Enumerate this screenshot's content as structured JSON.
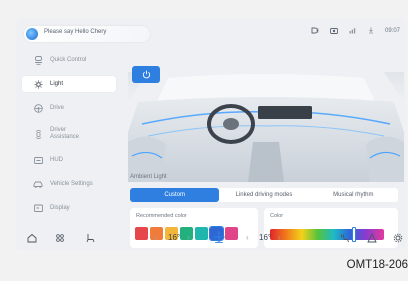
{
  "status_bar": {
    "voice_prompt": "Please say Hello Chery",
    "time": "09:07"
  },
  "sidebar": {
    "items": [
      {
        "label": "Quick Control",
        "icon": "quick-control-icon"
      },
      {
        "label": "Light",
        "icon": "light-icon",
        "active": true
      },
      {
        "label": "Drive",
        "icon": "drive-icon"
      },
      {
        "label": "Driver Assistance",
        "icon": "driver-assistance-icon"
      },
      {
        "label": "HUD",
        "icon": "hud-icon"
      },
      {
        "label": "Vehicle Settings",
        "icon": "vehicle-settings-icon"
      },
      {
        "label": "Display",
        "icon": "display-icon"
      }
    ]
  },
  "ambient": {
    "section_title": "Ambient Light",
    "tabs": [
      {
        "label": "Custom",
        "active": true
      },
      {
        "label": "Linked driving modes"
      },
      {
        "label": "Musical rhythm"
      }
    ],
    "recommended_title": "Recommended color",
    "swatches": [
      "#e5474b",
      "#ef7c3a",
      "#f2b63a",
      "#22b07d",
      "#1fb6ae",
      "#2e67d3",
      "#e0458a"
    ],
    "selected_swatch_index": 5,
    "color_title": "Color",
    "color_slider_position": 0.74
  },
  "bottom_bar": {
    "left_temp": "16°",
    "right_temp": "16°",
    "left_arrow": "‹",
    "right_arrow": "›"
  },
  "caption": "OMT18-206",
  "colors": {
    "accent": "#2f7fe0"
  }
}
